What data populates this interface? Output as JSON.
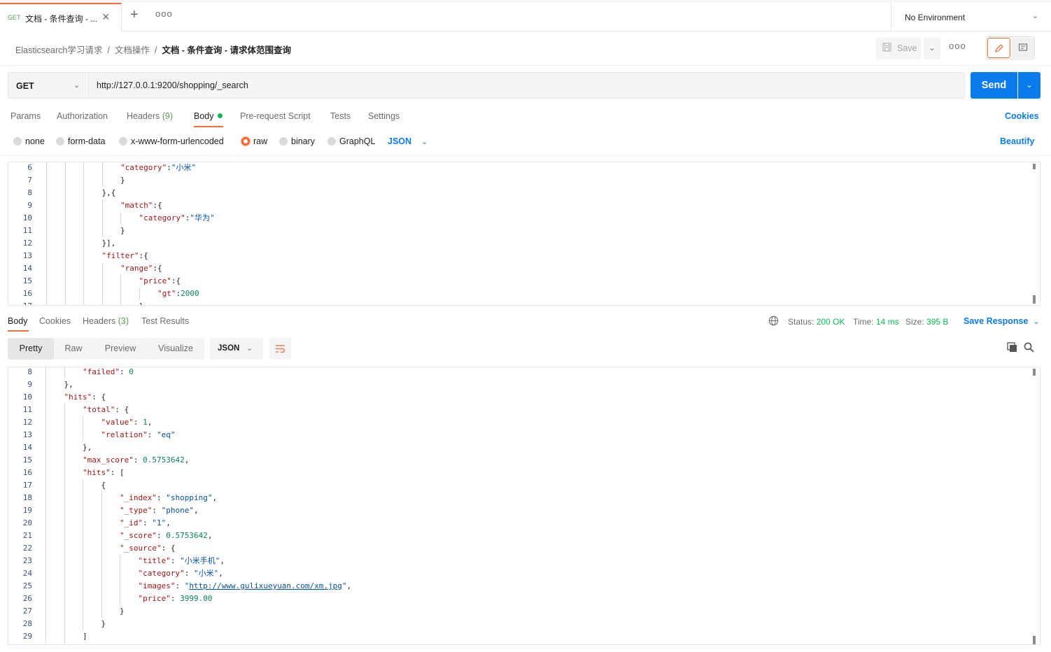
{
  "tab": {
    "method": "GET",
    "title": "文档 - 条件查询 - ...",
    "close": "×",
    "plus": "+",
    "more": "ooo"
  },
  "environment": {
    "label": "No Environment"
  },
  "breadcrumb": {
    "items": [
      "Elasticsearch学习请求",
      "文档操作"
    ],
    "current": "文档 - 条件查询 - 请求体范围查询",
    "sep": "/"
  },
  "toolbar": {
    "save_label": "Save",
    "more": "ooo"
  },
  "request": {
    "method": "GET",
    "url": "http://127.0.0.1:9200/shopping/_search",
    "send_label": "Send"
  },
  "request_tabs": {
    "params": "Params",
    "authorization": "Authorization",
    "headers": "Headers",
    "headers_count": "(9)",
    "body": "Body",
    "prerequest": "Pre-request Script",
    "tests": "Tests",
    "settings": "Settings",
    "cookies": "Cookies"
  },
  "body_types": {
    "none": "none",
    "form_data": "form-data",
    "urlencoded": "x-www-form-urlencoded",
    "raw": "raw",
    "binary": "binary",
    "graphql": "GraphQL",
    "format": "JSON",
    "beautify": "Beautify"
  },
  "request_body_lines": [
    {
      "n": "6",
      "indent": 4,
      "parts": [
        [
          "key",
          "\"category\""
        ],
        [
          "pun",
          ":"
        ],
        [
          "str",
          "\"小米\""
        ]
      ]
    },
    {
      "n": "7",
      "indent": 4,
      "parts": [
        [
          "pun",
          "}"
        ]
      ]
    },
    {
      "n": "8",
      "indent": 3,
      "parts": [
        [
          "pun",
          "},{"
        ]
      ]
    },
    {
      "n": "9",
      "indent": 4,
      "parts": [
        [
          "key",
          "\"match\""
        ],
        [
          "pun",
          ":{"
        ]
      ]
    },
    {
      "n": "10",
      "indent": 5,
      "parts": [
        [
          "key",
          "\"category\""
        ],
        [
          "pun",
          ":"
        ],
        [
          "str",
          "\"华为\""
        ]
      ]
    },
    {
      "n": "11",
      "indent": 4,
      "parts": [
        [
          "pun",
          "}"
        ]
      ]
    },
    {
      "n": "12",
      "indent": 3,
      "parts": [
        [
          "pun",
          "}],"
        ]
      ]
    },
    {
      "n": "13",
      "indent": 3,
      "parts": [
        [
          "key",
          "\"filter\""
        ],
        [
          "pun",
          ":{"
        ]
      ]
    },
    {
      "n": "14",
      "indent": 4,
      "parts": [
        [
          "key",
          "\"range\""
        ],
        [
          "pun",
          ":{"
        ]
      ]
    },
    {
      "n": "15",
      "indent": 5,
      "parts": [
        [
          "key",
          "\"price\""
        ],
        [
          "pun",
          ":{"
        ]
      ]
    },
    {
      "n": "16",
      "indent": 6,
      "parts": [
        [
          "key",
          "\"gt\""
        ],
        [
          "pun",
          ":"
        ],
        [
          "num",
          "2000"
        ]
      ]
    },
    {
      "n": "17",
      "indent": 5,
      "parts": [
        [
          "pun",
          "}"
        ]
      ]
    }
  ],
  "response_tabs": {
    "body": "Body",
    "cookies": "Cookies",
    "headers": "Headers",
    "headers_count": "(3)",
    "tests": "Test Results"
  },
  "response_status": {
    "status_label": "Status:",
    "status_value": "200 OK",
    "time_label": "Time:",
    "time_value": "14 ms",
    "size_label": "Size:",
    "size_value": "395 B",
    "save_response": "Save Response"
  },
  "response_view": {
    "pretty": "Pretty",
    "raw": "Raw",
    "preview": "Preview",
    "visualize": "Visualize",
    "format": "JSON"
  },
  "response_body_lines": [
    {
      "n": "8",
      "indent": 2,
      "parts": [
        [
          "key",
          "\"failed\""
        ],
        [
          "pun",
          ": "
        ],
        [
          "num",
          "0"
        ]
      ]
    },
    {
      "n": "9",
      "indent": 1,
      "parts": [
        [
          "pun",
          "},"
        ]
      ]
    },
    {
      "n": "10",
      "indent": 1,
      "parts": [
        [
          "key",
          "\"hits\""
        ],
        [
          "pun",
          ": {"
        ]
      ]
    },
    {
      "n": "11",
      "indent": 2,
      "parts": [
        [
          "key",
          "\"total\""
        ],
        [
          "pun",
          ": {"
        ]
      ]
    },
    {
      "n": "12",
      "indent": 3,
      "parts": [
        [
          "key",
          "\"value\""
        ],
        [
          "pun",
          ": "
        ],
        [
          "num",
          "1"
        ],
        [
          "pun",
          ","
        ]
      ]
    },
    {
      "n": "13",
      "indent": 3,
      "parts": [
        [
          "key",
          "\"relation\""
        ],
        [
          "pun",
          ": "
        ],
        [
          "str",
          "\"eq\""
        ]
      ]
    },
    {
      "n": "14",
      "indent": 2,
      "parts": [
        [
          "pun",
          "},"
        ]
      ]
    },
    {
      "n": "15",
      "indent": 2,
      "parts": [
        [
          "key",
          "\"max_score\""
        ],
        [
          "pun",
          ": "
        ],
        [
          "num",
          "0.5753642"
        ],
        [
          "pun",
          ","
        ]
      ]
    },
    {
      "n": "16",
      "indent": 2,
      "parts": [
        [
          "key",
          "\"hits\""
        ],
        [
          "pun",
          ": ["
        ]
      ]
    },
    {
      "n": "17",
      "indent": 3,
      "parts": [
        [
          "pun",
          "{"
        ]
      ]
    },
    {
      "n": "18",
      "indent": 4,
      "parts": [
        [
          "key",
          "\"_index\""
        ],
        [
          "pun",
          ": "
        ],
        [
          "str",
          "\"shopping\""
        ],
        [
          "pun",
          ","
        ]
      ]
    },
    {
      "n": "19",
      "indent": 4,
      "parts": [
        [
          "key",
          "\"_type\""
        ],
        [
          "pun",
          ": "
        ],
        [
          "str",
          "\"phone\""
        ],
        [
          "pun",
          ","
        ]
      ]
    },
    {
      "n": "20",
      "indent": 4,
      "parts": [
        [
          "key",
          "\"_id\""
        ],
        [
          "pun",
          ": "
        ],
        [
          "str",
          "\"1\""
        ],
        [
          "pun",
          ","
        ]
      ]
    },
    {
      "n": "21",
      "indent": 4,
      "parts": [
        [
          "key",
          "\"_score\""
        ],
        [
          "pun",
          ": "
        ],
        [
          "num",
          "0.5753642"
        ],
        [
          "pun",
          ","
        ]
      ]
    },
    {
      "n": "22",
      "indent": 4,
      "parts": [
        [
          "key",
          "\"_source\""
        ],
        [
          "pun",
          ": {"
        ]
      ]
    },
    {
      "n": "23",
      "indent": 5,
      "parts": [
        [
          "key",
          "\"title\""
        ],
        [
          "pun",
          ": "
        ],
        [
          "str",
          "\"小米手机\""
        ],
        [
          "pun",
          ","
        ]
      ]
    },
    {
      "n": "24",
      "indent": 5,
      "parts": [
        [
          "key",
          "\"category\""
        ],
        [
          "pun",
          ": "
        ],
        [
          "str",
          "\"小米\""
        ],
        [
          "pun",
          ","
        ]
      ]
    },
    {
      "n": "25",
      "indent": 5,
      "parts": [
        [
          "key",
          "\"images\""
        ],
        [
          "pun",
          ": "
        ],
        [
          "str",
          "\""
        ],
        [
          "link",
          "http://www.gulixueyuan.com/xm.jpg"
        ],
        [
          "str",
          "\""
        ],
        [
          "pun",
          ","
        ]
      ]
    },
    {
      "n": "26",
      "indent": 5,
      "parts": [
        [
          "key",
          "\"price\""
        ],
        [
          "pun",
          ": "
        ],
        [
          "num",
          "3999.00"
        ]
      ]
    },
    {
      "n": "27",
      "indent": 4,
      "parts": [
        [
          "pun",
          "}"
        ]
      ]
    },
    {
      "n": "28",
      "indent": 3,
      "parts": [
        [
          "pun",
          "}"
        ]
      ]
    },
    {
      "n": "29",
      "indent": 2,
      "parts": [
        [
          "pun",
          "]"
        ]
      ]
    }
  ],
  "colors": {
    "accent": "#f26b3a",
    "primary": "#097bed",
    "success": "#0cbb52"
  }
}
